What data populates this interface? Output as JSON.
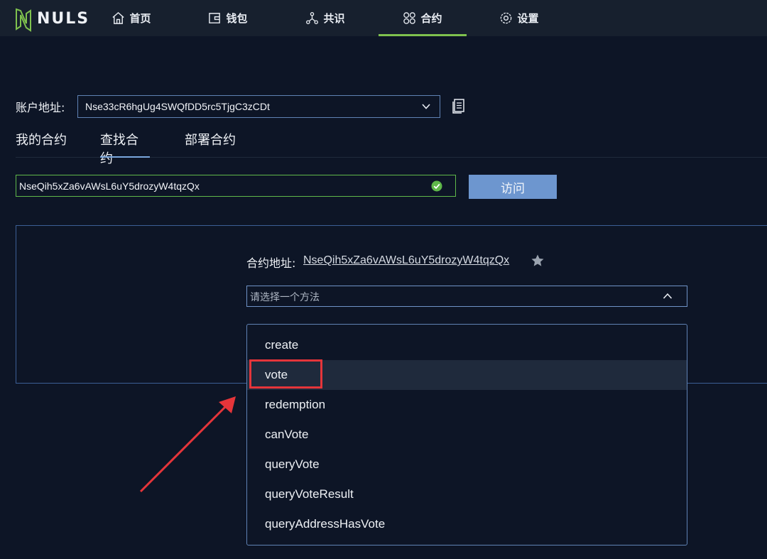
{
  "brand": {
    "name": "NULS",
    "accent": "#7fc24e"
  },
  "nav": {
    "items": [
      {
        "label": "首页",
        "icon": "home-icon"
      },
      {
        "label": "钱包",
        "icon": "wallet-icon"
      },
      {
        "label": "共识",
        "icon": "consensus-icon"
      },
      {
        "label": "合约",
        "icon": "contract-icon",
        "active": true
      },
      {
        "label": "设置",
        "icon": "gear-icon"
      }
    ]
  },
  "account": {
    "label": "账户地址:",
    "address": "Nse33cR6hgUg4SWQfDD5rc5TjgC3zCDt"
  },
  "tabs": [
    {
      "label": "我的合约"
    },
    {
      "label": "查找合约",
      "active": true
    },
    {
      "label": "部署合约"
    }
  ],
  "search": {
    "value": "NseQih5xZa6vAWsL6uY5drozyW4tqzQx",
    "visit_label": "访问"
  },
  "contract": {
    "address_label": "合约地址:",
    "address": "NseQih5xZa6vAWsL6uY5drozyW4tqzQx",
    "method_placeholder": "请选择一个方法"
  },
  "methods": [
    "create",
    "vote",
    "redemption",
    "canVote",
    "queryVote",
    "queryVoteResult",
    "queryAddressHasVote"
  ],
  "hovered_method": "vote",
  "colors": {
    "highlight": "#e5353a",
    "button": "#6d96cf",
    "valid": "#5fb84a"
  }
}
